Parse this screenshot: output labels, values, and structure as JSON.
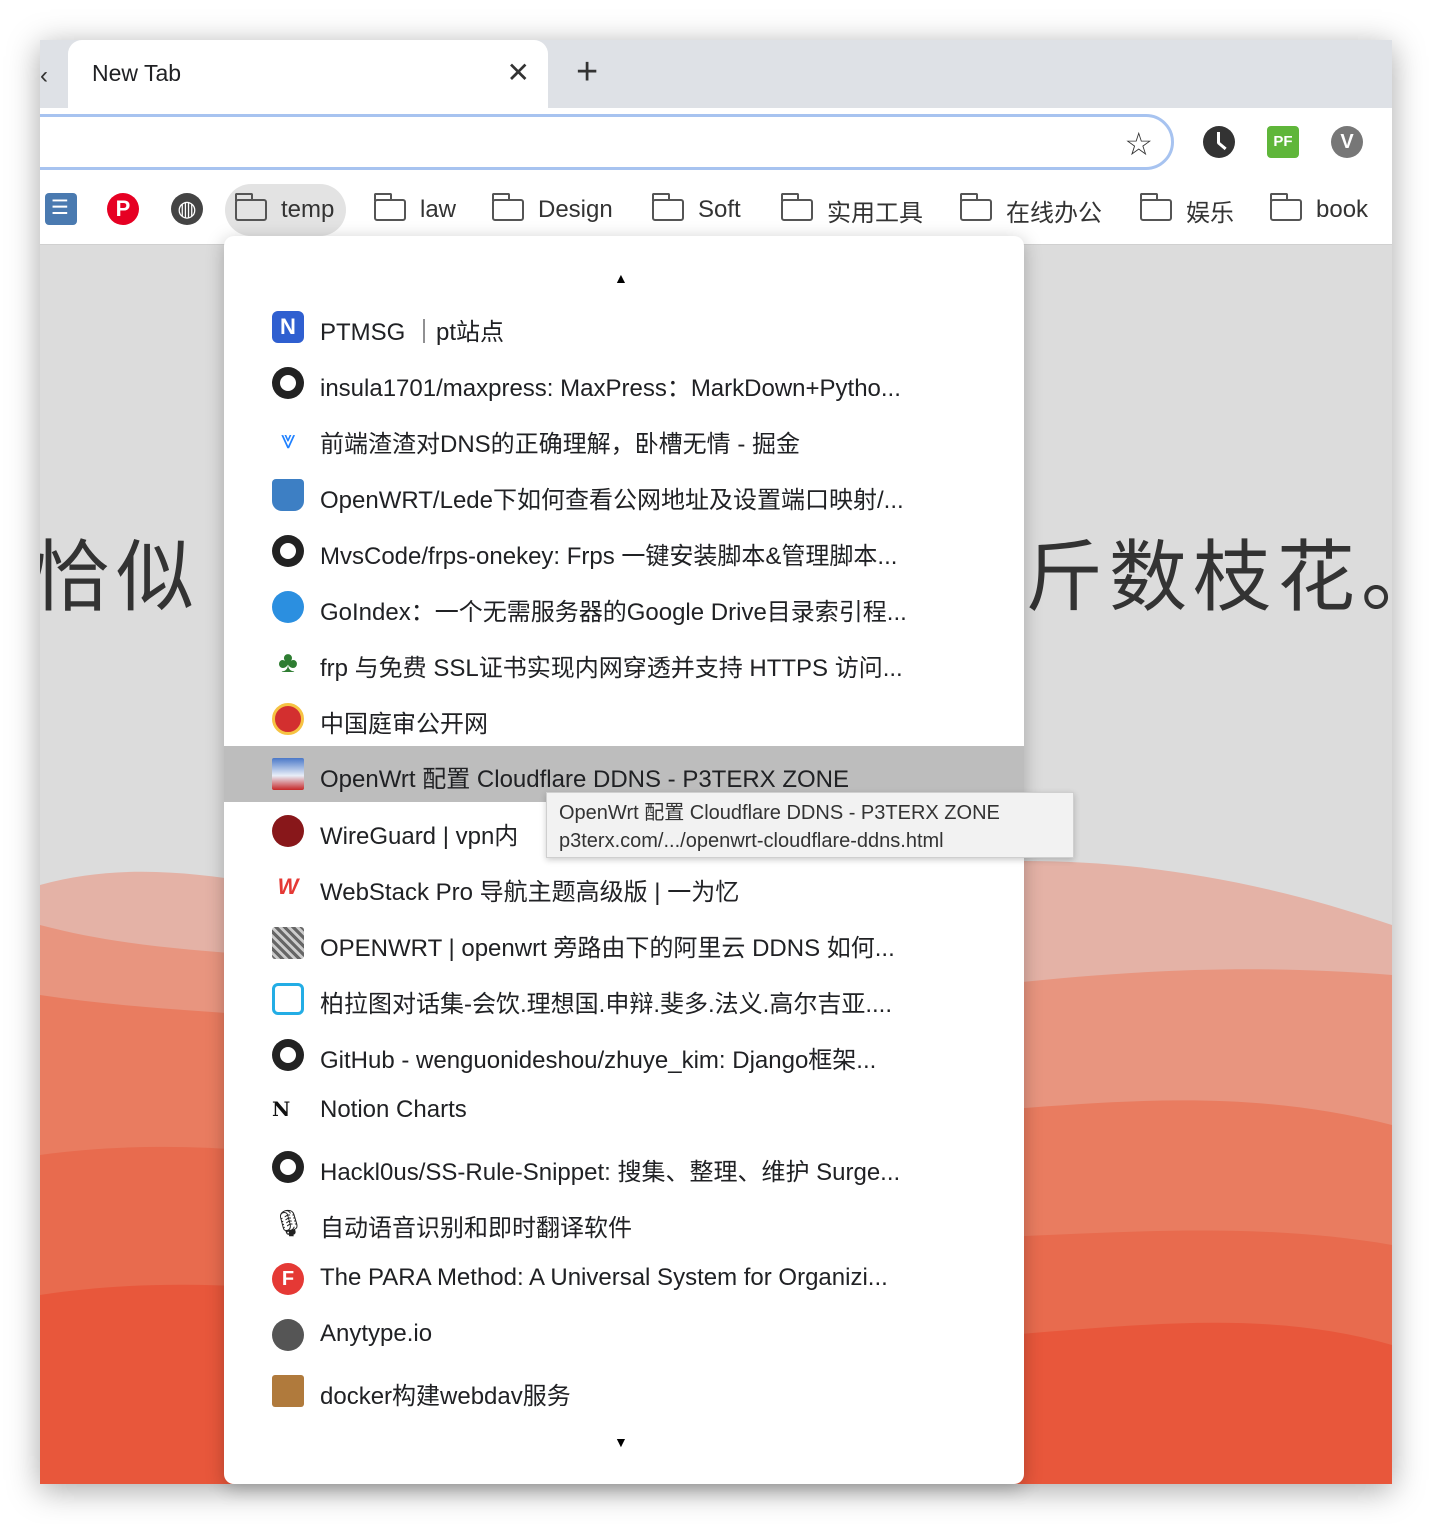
{
  "tab": {
    "title": "New Tab",
    "close": "✕",
    "new_tab": "+",
    "prev": "‹"
  },
  "toolbar": {
    "star_icon": "☆",
    "extensions": [
      "history-icon",
      "pf-icon",
      "v-icon"
    ],
    "pf_label": "PF",
    "v_label": "V"
  },
  "bookmarks": {
    "pinterest_glyph": "P",
    "globe_glyph": "◍",
    "folders": [
      "temp",
      "law",
      "Design",
      "Soft",
      "实用工具",
      "在线办公",
      "娱乐",
      "book"
    ]
  },
  "background": {
    "poem_left": "恰似",
    "poem_right": "斤数枝花。"
  },
  "menu": {
    "scroll_up": "▲",
    "scroll_down": "▼",
    "items": [
      {
        "label": "PTMSG ｜pt站点",
        "icon": "ptmsg-icon"
      },
      {
        "label": "insula1701/maxpress: MaxPress：MarkDown+Pytho...",
        "icon": "github-icon"
      },
      {
        "label": "前端渣渣对DNS的正确理解，卧槽无情 - 掘金",
        "icon": "juejin-icon"
      },
      {
        "label": "OpenWRT/Lede下如何查看公网地址及设置端口映射/...",
        "icon": "book-icon"
      },
      {
        "label": "MvsCode/frps-onekey: Frps 一键安装脚本&管理脚本...",
        "icon": "github-icon"
      },
      {
        "label": "GoIndex：一个无需服务器的Google Drive目录索引程...",
        "icon": "doraemon-icon"
      },
      {
        "label": "frp 与免费 SSL证书实现内网穿透并支持 HTTPS 访问...",
        "icon": "clover-icon"
      },
      {
        "label": "中国庭审公开网",
        "icon": "emblem-icon"
      },
      {
        "label": "OpenWrt 配置 Cloudflare DDNS - P3TERX ZONE",
        "icon": "p3terx-icon"
      },
      {
        "label": "WireGuard | vpn内",
        "icon": "wireguard-icon"
      },
      {
        "label": "WebStack Pro 导航主题高级版 | 一为忆",
        "icon": "webstack-icon"
      },
      {
        "label": "OPENWRT | openwrt 旁路由下的阿里云 DDNS 如何...",
        "icon": "openwrt-icon"
      },
      {
        "label": "柏拉图对话集-会饮.理想国.申辩.斐多.法义.高尔吉亚....",
        "icon": "bilibili-icon"
      },
      {
        "label": "GitHub - wenguonideshou/zhuye_kim: Django框架...",
        "icon": "github-icon"
      },
      {
        "label": "Notion Charts",
        "icon": "notion-vip-icon"
      },
      {
        "label": "Hackl0us/SS-Rule-Snippet: 搜集、整理、维护 Surge...",
        "icon": "github-icon"
      },
      {
        "label": "自动语音识别和即时翻译软件",
        "icon": "microphone-icon"
      },
      {
        "label": "The PARA Method: A Universal System for Organizi...",
        "icon": "forte-icon"
      },
      {
        "label": "Anytype.io",
        "icon": "globe-icon"
      },
      {
        "label": "docker构建webdav服务",
        "icon": "package-icon"
      }
    ]
  },
  "tooltip": {
    "title": "OpenWrt 配置 Cloudflare DDNS - P3TERX ZONE",
    "url": "p3terx.com/.../openwrt-cloudflare-ddns.html"
  },
  "colors": {
    "mountain_light": "#e4b2a6",
    "mountain_mid": "#e88a72",
    "mountain_dark": "#e8573b"
  }
}
